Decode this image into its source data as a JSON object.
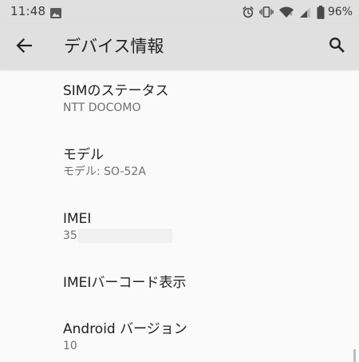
{
  "status_bar": {
    "time": "11:48",
    "battery_percent": "96%",
    "icons": [
      "gallery-icon",
      "alarm-icon",
      "vibrate-icon",
      "wifi-icon",
      "signal-icon",
      "battery-icon"
    ]
  },
  "app_bar": {
    "title": "デバイス情報",
    "back_icon": "arrow-back-icon",
    "search_icon": "search-icon"
  },
  "items": [
    {
      "title": "SIMのステータス",
      "subtitle": "NTT DOCOMO"
    },
    {
      "title": "モデル",
      "subtitle": "モデル: SO-52A"
    },
    {
      "title": "IMEI",
      "subtitle": "35"
    },
    {
      "title": "IMEIバーコード表示",
      "subtitle": ""
    },
    {
      "title": "Android バージョン",
      "subtitle": "10"
    }
  ],
  "colors": {
    "status_bar_bg": "#e0e0e0",
    "app_bar_bg": "#e0e0e0",
    "page_bg": "#fafafa",
    "primary_text": "#212121",
    "secondary_text": "#6f6f6f"
  }
}
